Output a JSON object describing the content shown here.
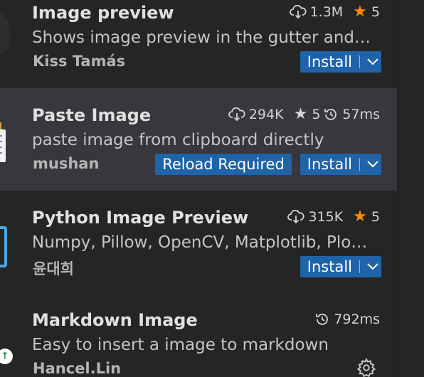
{
  "extensions": [
    {
      "name": "Image preview",
      "description": "Shows image preview in the gutter and…",
      "publisher": "Kiss Tamás",
      "downloads": "1.3M",
      "rating": "5",
      "install_label": "Install"
    },
    {
      "name": "Paste Image",
      "description": "paste image from clipboard directly",
      "publisher": "mushan",
      "downloads": "294K",
      "rating": "5",
      "activation_time": "57ms",
      "reload_label": "Reload Required",
      "install_label": "Install"
    },
    {
      "name": "Python Image Preview",
      "description": "Numpy, Pillow, OpenCV, Matplotlib, Plo…",
      "publisher": "윤대희",
      "downloads": "315K",
      "rating": "5",
      "install_label": "Install"
    },
    {
      "name": "Markdown Image",
      "description": "Easy to insert a image to markdown",
      "publisher": "Hancel.Lin",
      "activation_time": "792ms"
    }
  ],
  "icons": {
    "download": "cloud-download-icon",
    "star": "star-icon",
    "clock": "history-clock-icon",
    "chevron": "chevron-down-icon",
    "gear": "gear-icon"
  },
  "colors": {
    "background": "#252526",
    "selected_row": "#37373d",
    "button": "#1f64a8",
    "star_rating": "#ff8c00"
  }
}
